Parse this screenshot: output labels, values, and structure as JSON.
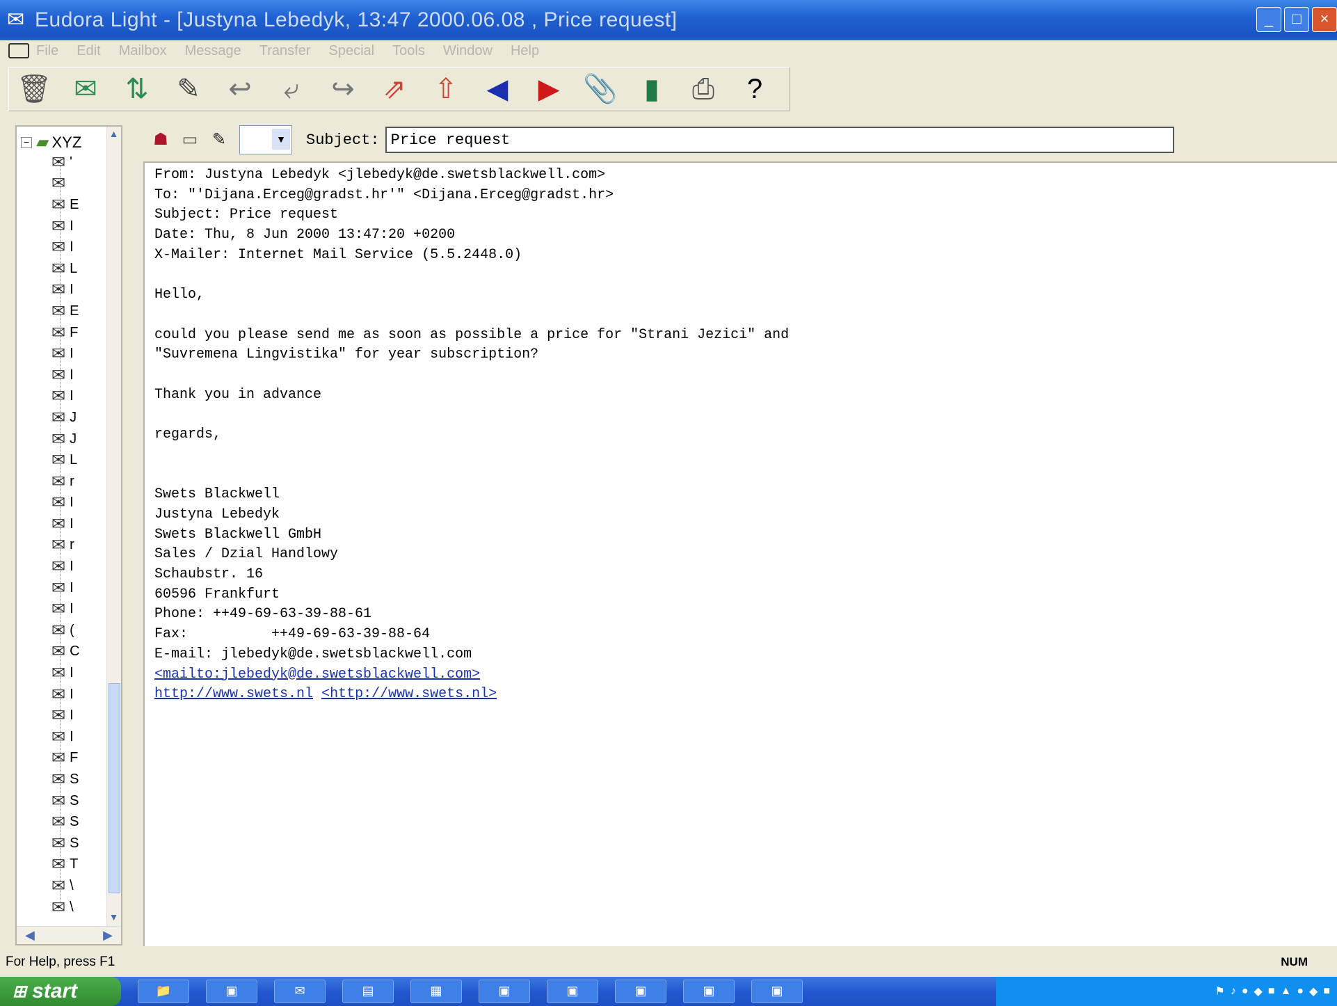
{
  "window": {
    "title": "Eudora Light - [Justyna Lebedyk, 13:47 2000.06.08 , Price request]"
  },
  "menu": [
    "File",
    "Edit",
    "Mailbox",
    "Message",
    "Transfer",
    "Special",
    "Tools",
    "Window",
    "Help"
  ],
  "toolbar": {
    "buttons": [
      "trash-icon",
      "check-mail-icon",
      "send-receive-icon",
      "new-message-icon",
      "reply-icon",
      "reply-all-icon",
      "forward-icon",
      "redirect-icon",
      "send-again-icon",
      "previous-message-icon",
      "next-message-icon",
      "attach-file-icon",
      "address-book-icon",
      "print-icon",
      "help-icon"
    ]
  },
  "tree": {
    "root_label": "XYZ",
    "item_letters": [
      "'",
      "",
      "E",
      "I",
      "I",
      "L",
      "I",
      "E",
      "F",
      "I",
      "I",
      "I",
      "J",
      "J",
      "L",
      "r",
      "I",
      "I",
      "r",
      "I",
      "I",
      "I",
      "(",
      "C",
      "I",
      "I",
      "I",
      "I",
      "F",
      "S",
      "S",
      "S",
      "S",
      "T",
      "\\",
      "\\"
    ]
  },
  "message_bar": {
    "priority_value": "",
    "subject_label": "Subject:",
    "subject_value": "Price request"
  },
  "message": {
    "from": "From: Justyna Lebedyk <jlebedyk@de.swetsblackwell.com>",
    "to": "To: \"'Dijana.Erceg@gradst.hr'\" <Dijana.Erceg@gradst.hr>",
    "subject": "Subject: Price request",
    "date": "Date: Thu, 8 Jun 2000 13:47:20 +0200",
    "mailer": "X-Mailer: Internet Mail Service (5.5.2448.0)",
    "greeting": "Hello,",
    "body_line1": "could you please send me as soon as possible a price for \"Strani Jezici\" and",
    "body_line2": "\"Suvremena Lingvistika\" for year subscription?",
    "thanks": "Thank you in advance",
    "closing": "regards,",
    "sig_company": "Swets Blackwell",
    "sig_name": "Justyna Lebedyk",
    "sig_company2": "Swets Blackwell GmbH",
    "sig_dept": "Sales / Dzial Handlowy",
    "sig_street": "Schaubstr. 16",
    "sig_city": "60596 Frankfurt",
    "sig_phone": "Phone: ++49-69-63-39-88-61",
    "sig_fax": "Fax:          ++49-69-63-39-88-64",
    "sig_email": "E-mail: jlebedyk@de.swetsblackwell.com",
    "sig_mailto": "<mailto:jlebedyk@de.swetsblackwell.com>",
    "sig_url": "http://www.swets.nl",
    "sig_url2": "<http://www.swets.nl>"
  },
  "status": {
    "help_text": "For Help, press F1",
    "num_indicator": "NUM"
  },
  "taskbar": {
    "start_label": "start"
  }
}
